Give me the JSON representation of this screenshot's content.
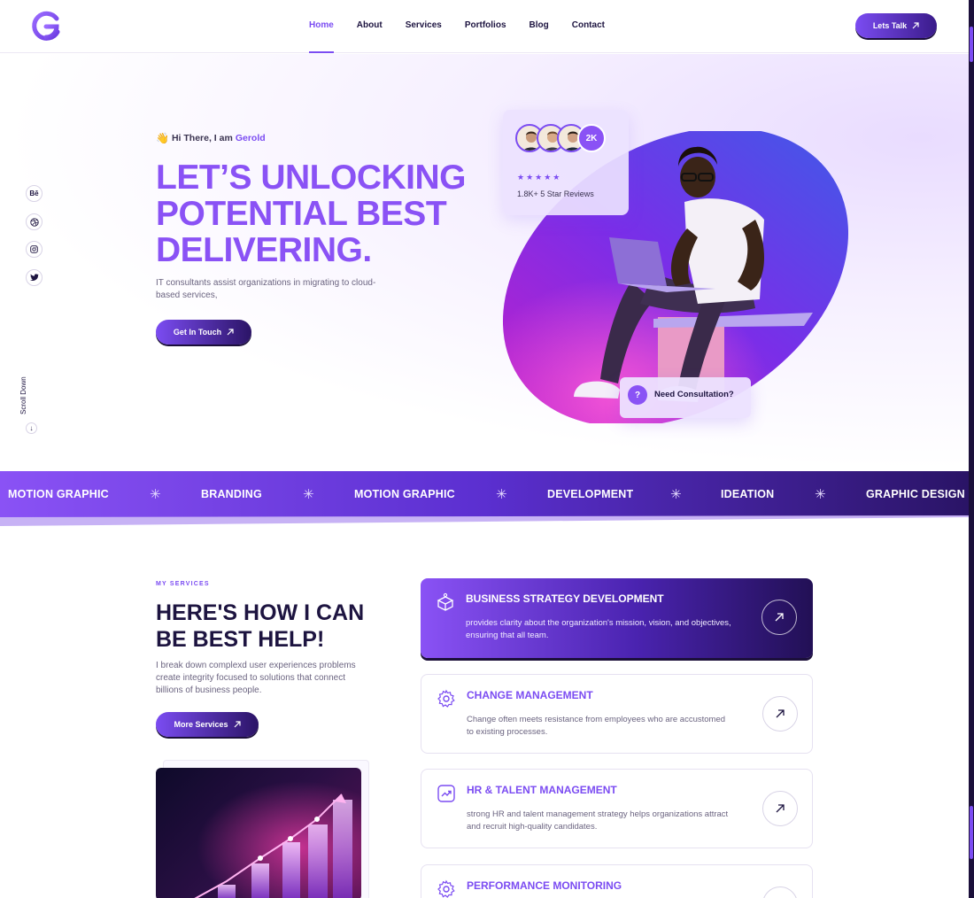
{
  "header": {
    "nav": [
      {
        "label": "Home",
        "active": true
      },
      {
        "label": "About",
        "active": false
      },
      {
        "label": "Services",
        "active": false
      },
      {
        "label": "Portfolios",
        "active": false
      },
      {
        "label": "Blog",
        "active": false
      },
      {
        "label": "Contact",
        "active": false
      }
    ],
    "cta_label": "Lets Talk"
  },
  "social": [
    {
      "icon": "behance-icon",
      "glyph": "Bē"
    },
    {
      "icon": "dribbble-icon",
      "glyph": ""
    },
    {
      "icon": "instagram-icon",
      "glyph": ""
    },
    {
      "icon": "twitter-icon",
      "glyph": ""
    }
  ],
  "scroll_down_label": "Scroll Down",
  "hero": {
    "greeting_prefix": "Hi There, I am",
    "greeting_name": "Gerold",
    "title_lines": [
      "LET’S UNLOCKING",
      "POTENTIAL BEST",
      "DELIVERING."
    ],
    "description": "IT consultants assist organizations in migrating to cloud-based services,",
    "cta_label": "Get In Touch",
    "reviews_count_badge": "2K",
    "stars": "★★★★★",
    "reviews_text": "1.8K+ 5 Star Reviews",
    "consult_badge": "?",
    "consult_label": "Need Consultation?"
  },
  "marquee": [
    "MOTION GRAPHIC",
    "BRANDING",
    "MOTION GRAPHIC",
    "DEVELOPMENT",
    "IDEATION",
    "GRAPHIC DESIGN"
  ],
  "services": {
    "label": "MY SERVICES",
    "title_lines": [
      "HERE'S HOW I CAN",
      "BE BEST HELP!"
    ],
    "description": "I break down complexd user experiences problems create integrity focused to solutions that connect billions of business people.",
    "cta_label": "More Services",
    "cards": [
      {
        "title": "BUSINESS STRATEGY DEVELOPMENT",
        "desc": "provides clarity about the organization's mission, vision, and objectives, ensuring that all team.",
        "icon": "strategy-box-icon",
        "active": true
      },
      {
        "title": "CHANGE MANAGEMENT",
        "desc": "Change often meets resistance from employees who are accustomed to existing processes.",
        "icon": "gear-icon",
        "active": false
      },
      {
        "title": "HR & TALENT MANAGEMENT",
        "desc": "strong HR and talent management strategy helps organizations attract and recruit high-quality candidates.",
        "icon": "trend-chart-icon",
        "active": false
      },
      {
        "title": "PERFORMANCE MONITORING",
        "desc": "",
        "icon": "gear-icon",
        "active": false
      }
    ]
  },
  "colors": {
    "accent": "#7b4cf2",
    "dark": "#1d1440",
    "deep": "#2a1466"
  }
}
